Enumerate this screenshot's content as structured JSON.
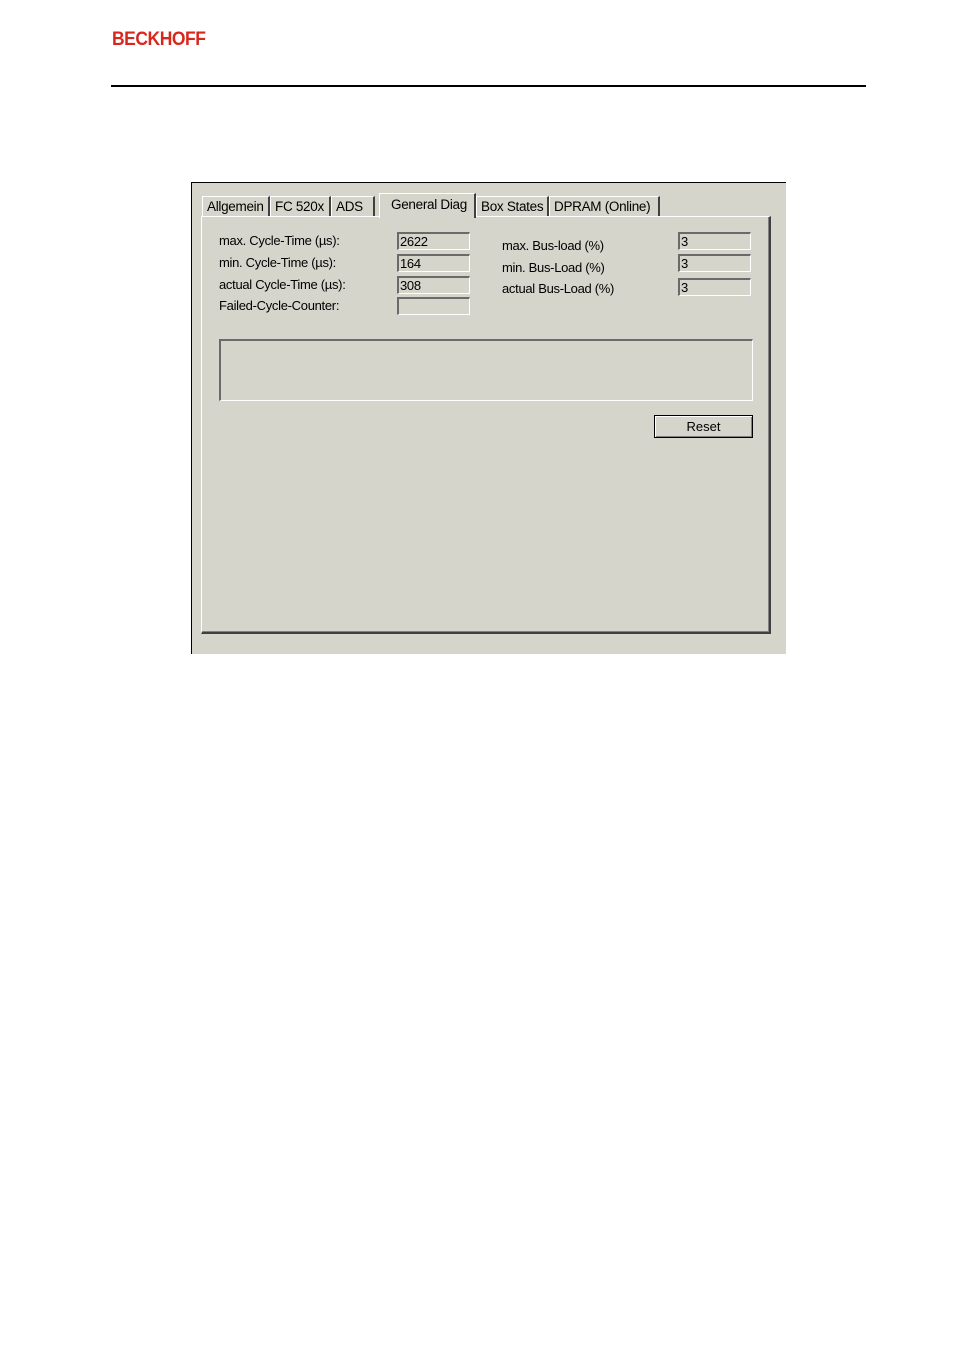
{
  "header": {
    "brand": "BECKHOFF",
    "brand_color": "#d8281e"
  },
  "dialog": {
    "tabs": [
      {
        "label": "Allgemein",
        "active": false
      },
      {
        "label": "FC 520x",
        "active": false
      },
      {
        "label": "ADS",
        "active": false
      },
      {
        "label": "General Diag",
        "active": true
      },
      {
        "label": "Box States",
        "active": false
      },
      {
        "label": "DPRAM (Online)",
        "active": false
      }
    ],
    "cycle": {
      "max_label": "max. Cycle-Time (µs):",
      "max_value": "2622",
      "min_label": "min. Cycle-Time (µs):",
      "min_value": "164",
      "actual_label": "actual Cycle-Time (µs):",
      "actual_value": "308",
      "failed_label": "Failed-Cycle-Counter:",
      "failed_value": ""
    },
    "busload": {
      "max_label": "max. Bus-load (%)",
      "max_value": "3",
      "min_label": "min. Bus-Load (%)",
      "min_value": "3",
      "actual_label": "actual Bus-Load (%)",
      "actual_value": "3"
    },
    "message_box": "",
    "reset_label": "Reset"
  }
}
